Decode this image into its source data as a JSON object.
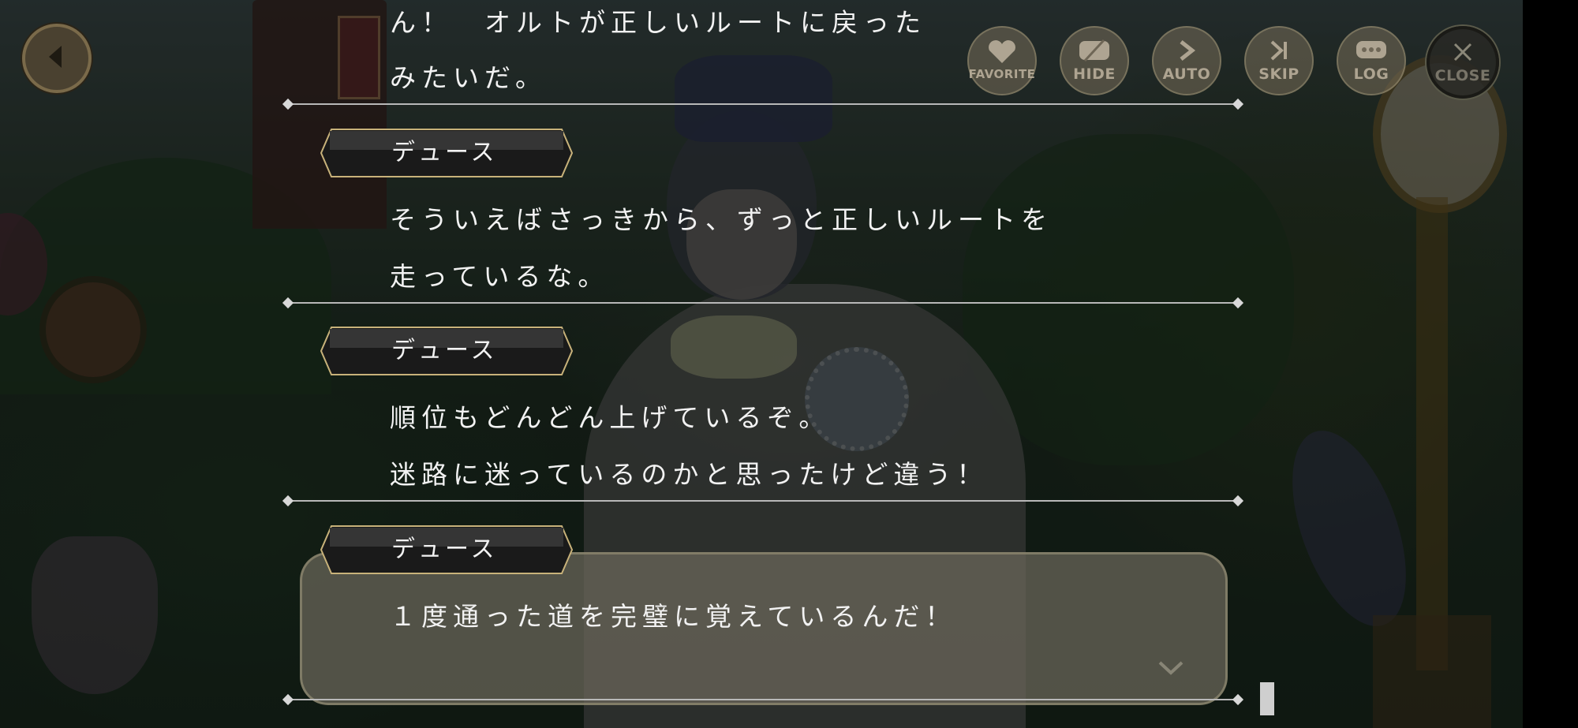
{
  "menu": {
    "favorite_label": "FAVORITE",
    "hide_label": "HIDE",
    "auto_label": "AUTO",
    "skip_label": "SKIP",
    "log_label": "LOG",
    "close_label": "CLOSE"
  },
  "log_entries": [
    {
      "speaker": "",
      "lines": [
        "ん！　オルトが正しいルートに戻った",
        "みたいだ。"
      ]
    },
    {
      "speaker": "デュース",
      "lines": [
        "そういえばさっきから、ずっと正しいルートを",
        "走っているな。"
      ]
    },
    {
      "speaker": "デュース",
      "lines": [
        "順位もどんどん上げているぞ。",
        "迷路に迷っているのかと思ったけど違う！"
      ]
    },
    {
      "speaker": "デュース",
      "lines": [
        "１度通った道を完璧に覚えているんだ！"
      ]
    }
  ],
  "colors": {
    "name_plate_border": "#c8b27a",
    "menu_text": "#beb4a0",
    "divider": "#b8b8b8"
  }
}
